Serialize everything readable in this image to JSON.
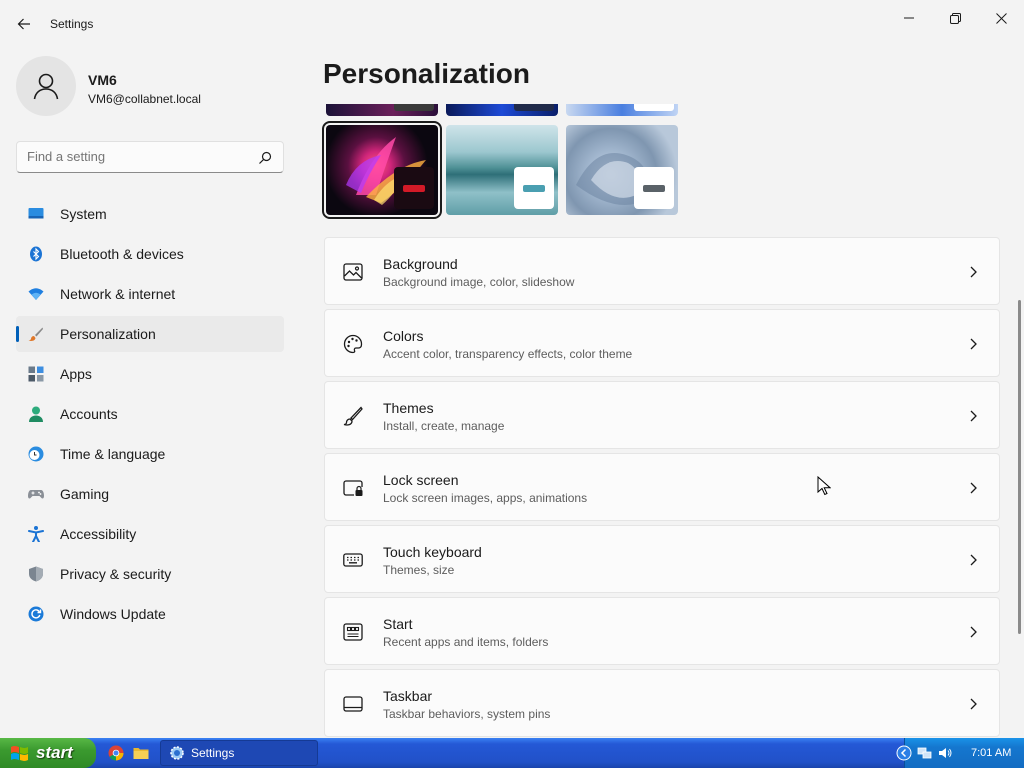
{
  "window": {
    "title": "Settings",
    "back_icon": "back-arrow-icon",
    "controls": [
      "minimize-icon",
      "maximize-icon",
      "close-icon"
    ]
  },
  "profile": {
    "name": "VM6",
    "email": "VM6@collabnet.local",
    "avatar_icon": "user-icon"
  },
  "search": {
    "placeholder": "Find a setting",
    "icon": "search-icon"
  },
  "sidebar": {
    "active": "Personalization",
    "items": [
      {
        "label": "System",
        "icon": "system-icon"
      },
      {
        "label": "Bluetooth & devices",
        "icon": "bluetooth-icon"
      },
      {
        "label": "Network & internet",
        "icon": "wifi-icon"
      },
      {
        "label": "Personalization",
        "icon": "paintbrush-icon"
      },
      {
        "label": "Apps",
        "icon": "apps-icon"
      },
      {
        "label": "Accounts",
        "icon": "accounts-icon"
      },
      {
        "label": "Time & language",
        "icon": "clock-globe-icon"
      },
      {
        "label": "Gaming",
        "icon": "gamepad-icon"
      },
      {
        "label": "Accessibility",
        "icon": "accessibility-icon"
      },
      {
        "label": "Privacy & security",
        "icon": "shield-icon"
      },
      {
        "label": "Windows Update",
        "icon": "update-icon"
      }
    ]
  },
  "main": {
    "page_title": "Personalization",
    "themes": {
      "selected_index": 0,
      "accent_colors": [
        "#d21a27",
        "#4a9fb1",
        "#5a6268"
      ]
    },
    "cards": [
      {
        "title": "Background",
        "subtitle": "Background image, color, slideshow",
        "icon": "image-icon"
      },
      {
        "title": "Colors",
        "subtitle": "Accent color, transparency effects, color theme",
        "icon": "palette-icon"
      },
      {
        "title": "Themes",
        "subtitle": "Install, create, manage",
        "icon": "brush-icon"
      },
      {
        "title": "Lock screen",
        "subtitle": "Lock screen images, apps, animations",
        "icon": "lock-screen-icon"
      },
      {
        "title": "Touch keyboard",
        "subtitle": "Themes, size",
        "icon": "keyboard-icon"
      },
      {
        "title": "Start",
        "subtitle": "Recent apps and items, folders",
        "icon": "start-icon"
      },
      {
        "title": "Taskbar",
        "subtitle": "Taskbar behaviors, system pins",
        "icon": "taskbar-icon"
      }
    ]
  },
  "taskbar": {
    "start_label": "start",
    "task_label": "Settings",
    "clock": "7:01 AM"
  }
}
